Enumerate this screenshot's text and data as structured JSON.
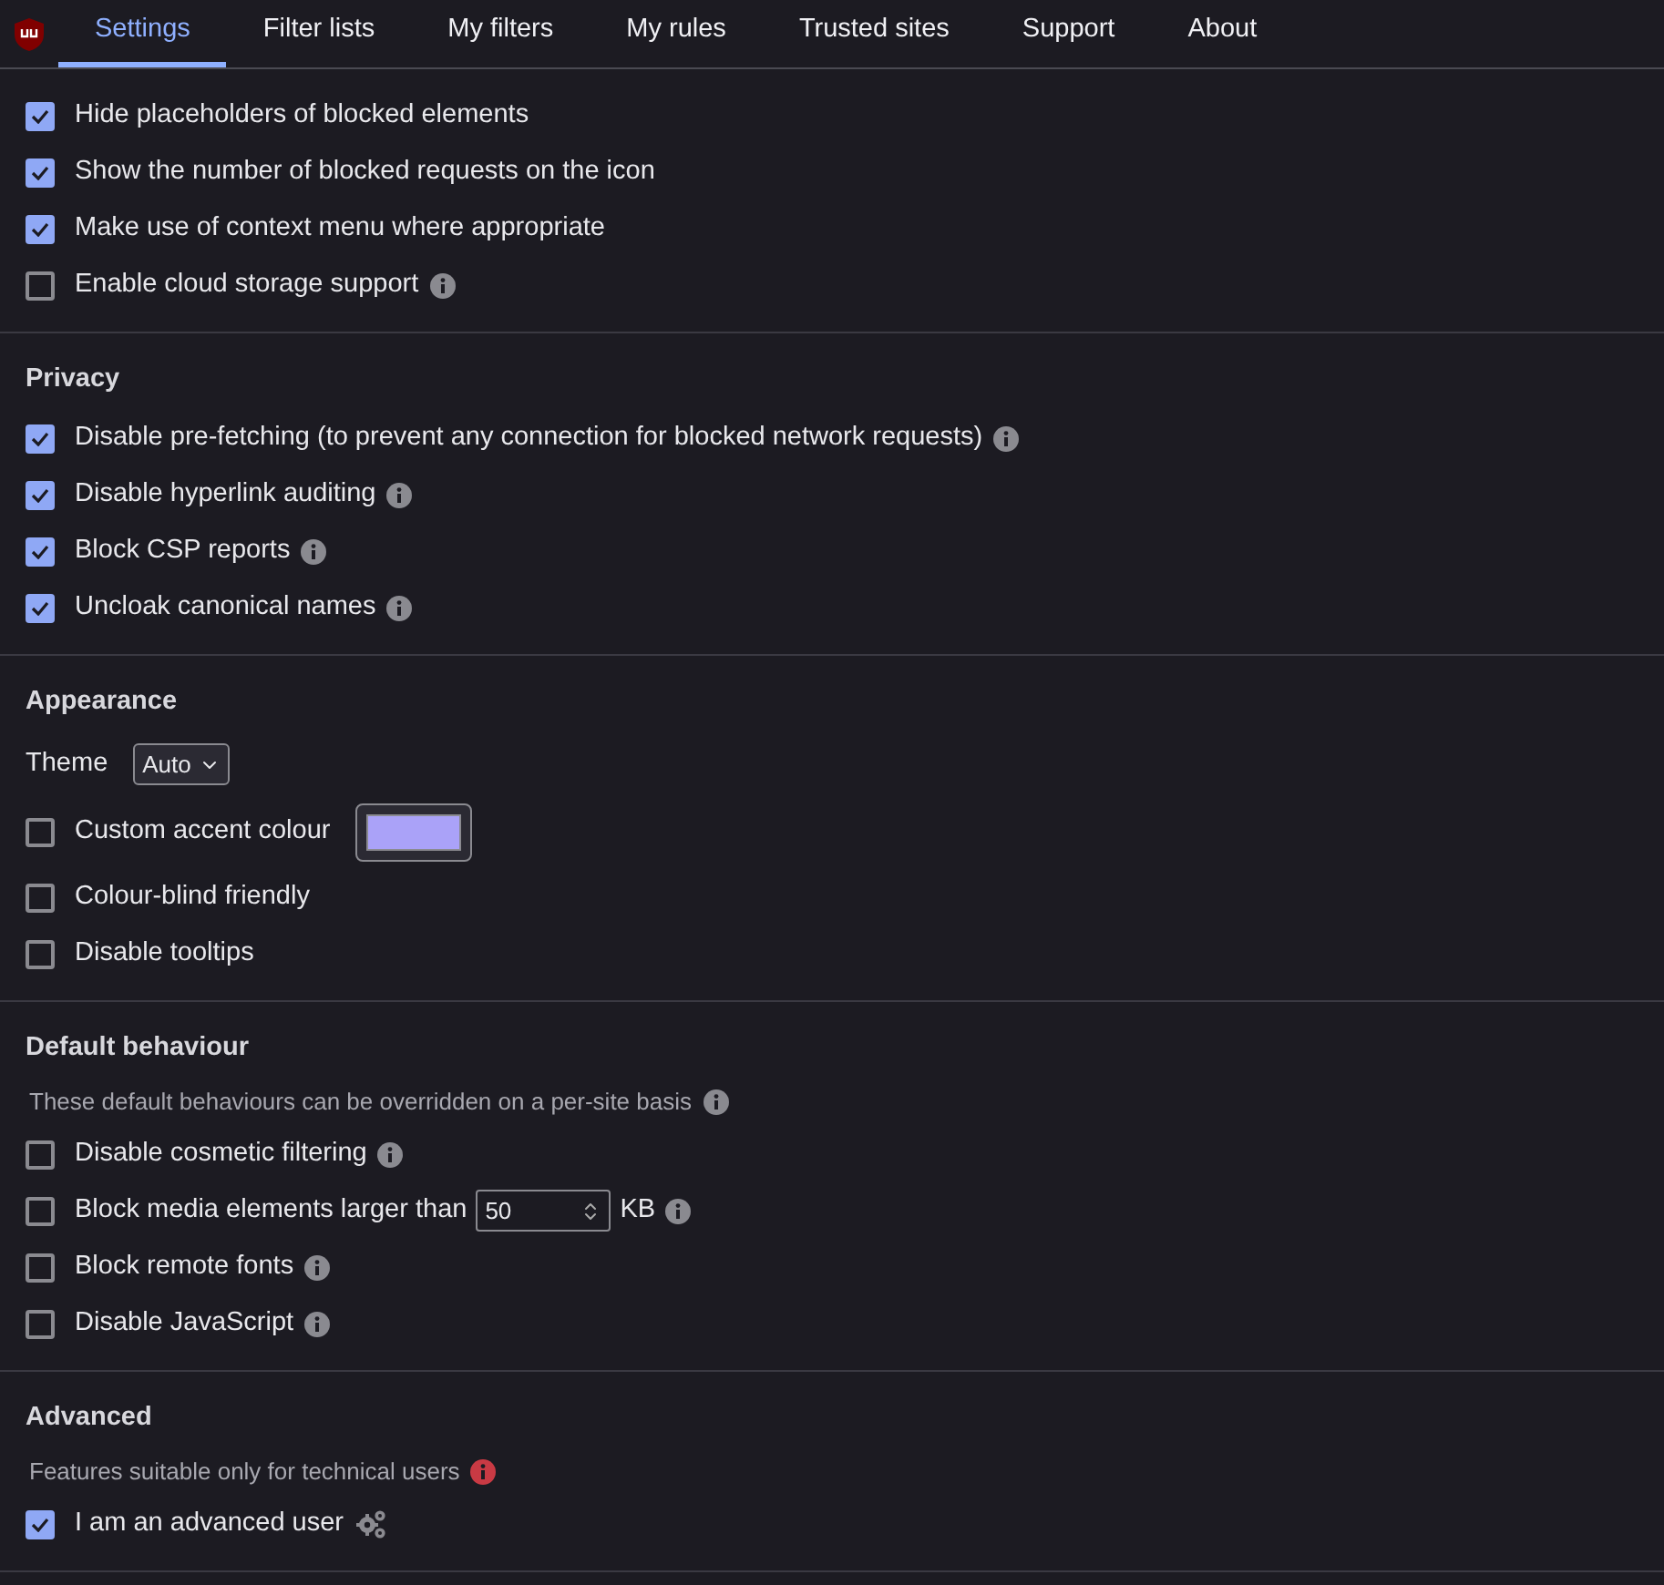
{
  "tabs": [
    {
      "label": "Settings",
      "selected": true
    },
    {
      "label": "Filter lists",
      "selected": false
    },
    {
      "label": "My filters",
      "selected": false
    },
    {
      "label": "My rules",
      "selected": false
    },
    {
      "label": "Trusted sites",
      "selected": false
    },
    {
      "label": "Support",
      "selected": false
    },
    {
      "label": "About",
      "selected": false
    }
  ],
  "sections": [
    {
      "items": [
        {
          "kind": "checkbox",
          "label": "Hide placeholders of blocked elements",
          "checked": true,
          "info": false
        },
        {
          "kind": "checkbox",
          "label": "Show the number of blocked requests on the icon",
          "checked": true,
          "info": false
        },
        {
          "kind": "checkbox",
          "label": "Make use of context menu where appropriate",
          "checked": true,
          "info": false
        },
        {
          "kind": "checkbox",
          "label": "Enable cloud storage support",
          "checked": false,
          "info": true
        }
      ]
    },
    {
      "title": "Privacy",
      "items": [
        {
          "kind": "checkbox",
          "label": "Disable pre-fetching (to prevent any connection for blocked network requests)",
          "checked": true,
          "info": true
        },
        {
          "kind": "checkbox",
          "label": "Disable hyperlink auditing",
          "checked": true,
          "info": true
        },
        {
          "kind": "checkbox",
          "label": "Block CSP reports",
          "checked": true,
          "info": true
        },
        {
          "kind": "checkbox",
          "label": "Uncloak canonical names",
          "checked": true,
          "info": true
        }
      ]
    },
    {
      "title": "Appearance",
      "items": [
        {
          "kind": "select",
          "label": "Theme",
          "value": "Auto"
        },
        {
          "kind": "color",
          "label": "Custom accent colour",
          "checked": false
        },
        {
          "kind": "checkbox",
          "label": "Colour-blind friendly",
          "checked": false,
          "info": false
        },
        {
          "kind": "checkbox",
          "label": "Disable tooltips",
          "checked": false,
          "info": false
        }
      ]
    },
    {
      "title": "Default behaviour",
      "note": "These default behaviours can be overridden on a per-site basis",
      "warning": false,
      "items": [
        {
          "kind": "checkbox",
          "label": "Disable cosmetic filtering",
          "checked": false,
          "info": true
        },
        {
          "kind": "number",
          "label": "Block media elements larger than",
          "checked": false,
          "value": "50",
          "unit": "KB"
        },
        {
          "kind": "checkbox",
          "label": "Block remote fonts",
          "checked": false,
          "info": true
        },
        {
          "kind": "checkbox",
          "label": "Disable JavaScript",
          "checked": false,
          "info": true
        }
      ]
    },
    {
      "title": "Advanced",
      "note": "Features suitable only for technical users",
      "warning": true,
      "items": [
        {
          "kind": "gears",
          "label": "I am an advanced user",
          "checked": true
        }
      ]
    }
  ]
}
